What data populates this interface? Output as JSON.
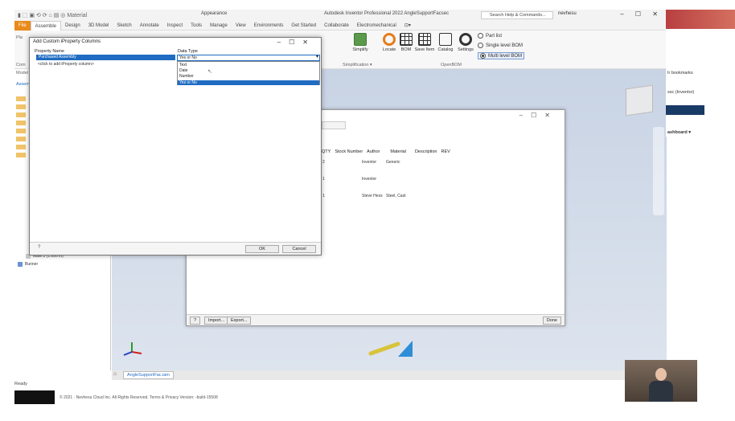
{
  "app": {
    "title": "Autodesk Inventor Professional 2022   AngleSupportFacsec",
    "search_placeholder": "Search Help & Commands...",
    "user": "nevhesu",
    "window_controls": "–  ☐  ✕",
    "quick_access": "▮ ⬚ ▣ ⟲ ⟳ ⌂ ▤ ◎ Material",
    "appearance": "Appearance"
  },
  "ribbon_tabs": [
    "File",
    "Assemble",
    "Design",
    "3D Model",
    "Sketch",
    "Annotate",
    "Inspect",
    "Tools",
    "Manage",
    "View",
    "Environments",
    "Get Started",
    "Collaborate",
    "Electromechanical",
    "⊡▾"
  ],
  "ribbon": {
    "buttons": [
      {
        "label": "Simplify"
      },
      {
        "label": "Locate"
      },
      {
        "label": "BOM"
      },
      {
        "label": "Save Item"
      },
      {
        "label": "Catalog"
      },
      {
        "label": "Settings"
      }
    ],
    "radios": [
      {
        "label": "Part list",
        "selected": false
      },
      {
        "label": "Single level BOM",
        "selected": false
      },
      {
        "label": "Multi level BOM",
        "selected": true
      }
    ],
    "panel_simplification": "Simplification ▾",
    "panel_openbom": "OpenBOM",
    "left_labels": [
      "Pla",
      "Com",
      "Model",
      "Assem"
    ]
  },
  "dialog": {
    "title": "Add Custom iProperty Columns",
    "col_property": "Property Name",
    "col_datatype": "Data Type",
    "selected_property": "Purchased Assembly",
    "add_row_hint": "<click to add iProperty column>",
    "datatype_value": "Yes or No",
    "datatype_options": [
      "Text",
      "Date",
      "Number",
      "Yes or No"
    ],
    "ok": "OK",
    "cancel": "Cancel"
  },
  "bom": {
    "headers": [
      "QTY",
      "Stock Number",
      "Author",
      "Material",
      "Description",
      "REV"
    ],
    "rows": [
      {
        "qty": "2",
        "author": "Inventor",
        "material": "Generic"
      },
      {
        "qty": "1",
        "author": "Inventor",
        "material": ""
      },
      {
        "qty": "1",
        "author": "Steve Hess",
        "material": "Steel, Cast"
      }
    ],
    "import": "Import...",
    "export": "Export...",
    "done": "Done"
  },
  "browser": {
    "items": [
      "Mate:3 (1.000 in)",
      "Bunner"
    ]
  },
  "doc_tab": "AngleSupportFac.iam",
  "status": "Ready",
  "footer": "© 2021 · Nevhesu Cloud Inc. All Rights Reserved.   Terms & Privacy   Version: -build-15508",
  "right_strip": {
    "bookmarks": "Ir bookmarks",
    "inventor": "ssc (Inventor)",
    "dashboard": "ashboard ▾"
  }
}
